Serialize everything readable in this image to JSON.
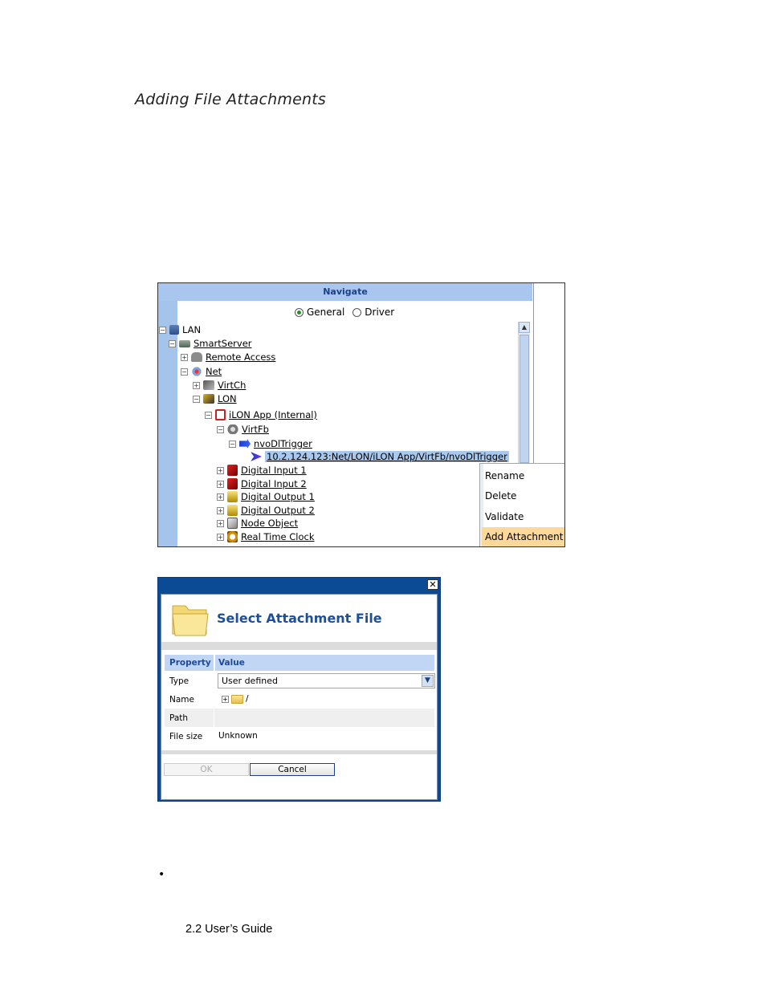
{
  "heading": "Adding File Attachments",
  "navigate": {
    "title": "Navigate",
    "radio_general": "General",
    "radio_driver": "Driver",
    "tree": {
      "lan": "LAN",
      "smartserver": "SmartServer",
      "remote_access": "Remote Access",
      "net": "Net",
      "virtch": "VirtCh",
      "lon": "LON",
      "ilon_app": "iLON App (Internal)",
      "virtfb": "VirtFb",
      "nvodltrigger": "nvoDlTrigger",
      "binding": "10.2.124.123:Net/LON/iLON App/VirtFb/nvoDlTrigger",
      "digital_input_1": "Digital Input 1",
      "digital_input_2": "Digital Input 2",
      "digital_output_1": "Digital Output 1",
      "digital_output_2": "Digital Output 2",
      "node_object": "Node Object",
      "real_time_clock": "Real Time Clock"
    },
    "context_menu": {
      "rename": "Rename",
      "delete": "Delete",
      "validate": "Validate",
      "add_attachment": "Add Attachment"
    }
  },
  "dialog": {
    "title": "Select Attachment File",
    "close": "✕",
    "col_property": "Property",
    "col_value": "Value",
    "rows": {
      "type_label": "Type",
      "type_value": "User defined",
      "name_label": "Name",
      "name_value": "/",
      "path_label": "Path",
      "filesize_label": "File size",
      "filesize_value": "Unknown"
    },
    "ok": "OK",
    "cancel": "Cancel"
  },
  "bullet": "•",
  "footer": "2.2 User’s Guide"
}
